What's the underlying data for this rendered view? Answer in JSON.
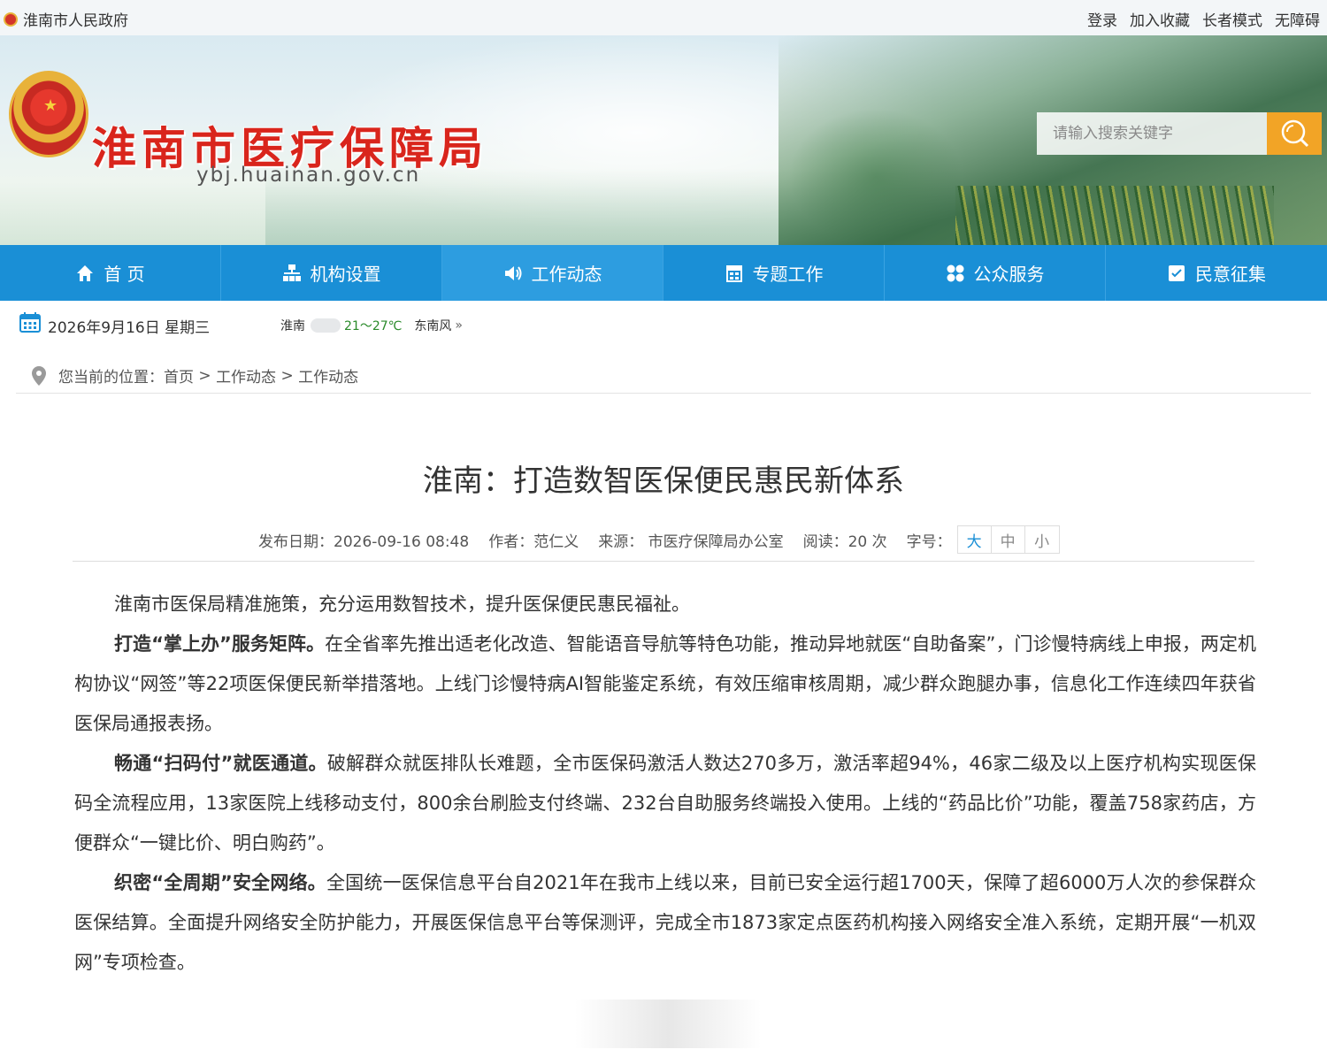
{
  "topbar": {
    "gov_link": "淮南市人民政府",
    "links": [
      "登录",
      "加入收藏",
      "长者模式",
      "无障碍"
    ]
  },
  "header": {
    "site_title": "淮南市医疗保障局",
    "site_domain": "ybj.huainan.gov.cn",
    "search_placeholder": "请输入搜索关键字"
  },
  "nav": {
    "items": [
      {
        "label": "首 页",
        "icon": "home-icon"
      },
      {
        "label": "机构设置",
        "icon": "org-chart-icon"
      },
      {
        "label": "工作动态",
        "icon": "speaker-icon"
      },
      {
        "label": "专题工作",
        "icon": "building-icon"
      },
      {
        "label": "公众服务",
        "icon": "grid-icon"
      },
      {
        "label": "民意征集",
        "icon": "clipboard-icon"
      }
    ],
    "active_index": 2
  },
  "info": {
    "date": "2026年9月16日  星期三",
    "weather_city": "淮南",
    "weather_temp": "21～27℃",
    "weather_wind": "东南风",
    "weather_more": "»"
  },
  "breadcrumb": {
    "prefix": "您当前的位置：",
    "items": [
      "首页",
      "工作动态",
      "工作动态"
    ],
    "separator": " > "
  },
  "article": {
    "title": "淮南：打造数智医保便民惠民新体系",
    "meta": {
      "date": "发布日期：2026-09-16 08:48",
      "author": "作者：范仁义",
      "source": "来源： 市医疗保障局办公室",
      "reads": "阅读：20 次",
      "fontsize_label": "字号：",
      "sizes": [
        "大",
        "中",
        "小"
      ]
    },
    "paragraphs": [
      {
        "bold": "",
        "text": "淮南市医保局精准施策，充分运用数智技术，提升医保便民惠民福祉。"
      },
      {
        "bold": "打造“掌上办”服务矩阵。",
        "text": "在全省率先推出适老化改造、智能语音导航等特色功能，推动异地就医“自助备案”，门诊慢特病线上申报，两定机构协议“网签”等22项医保便民新举措落地。上线门诊慢特病AI智能鉴定系统，有效压缩审核周期，减少群众跑腿办事，信息化工作连续四年获省医保局通报表扬。"
      },
      {
        "bold": "畅通“扫码付”就医通道。",
        "text": "破解群众就医排队长难题，全市医保码激活人数达270多万，激活率超94%，46家二级及以上医疗机构实现医保码全流程应用，13家医院上线移动支付，800余台刷脸支付终端、232台自助服务终端投入使用。上线的“药品比价”功能，覆盖758家药店，方便群众“一键比价、明白购药”。"
      },
      {
        "bold": "织密“全周期”安全网络。",
        "text": "全国统一医保信息平台自2021年在我市上线以来，目前已安全运行超1700天，保障了超6000万人次的参保群众医保结算。全面提升网络安全防护能力，开展医保信息平台等保测评，完成全市1873家定点医药机构接入网络安全准入系统，定期开展“一机双网”专项检查。"
      }
    ]
  },
  "colors": {
    "nav_blue": "#1a8fd6",
    "title_red": "#d9251c",
    "search_orange": "#f2a426"
  }
}
